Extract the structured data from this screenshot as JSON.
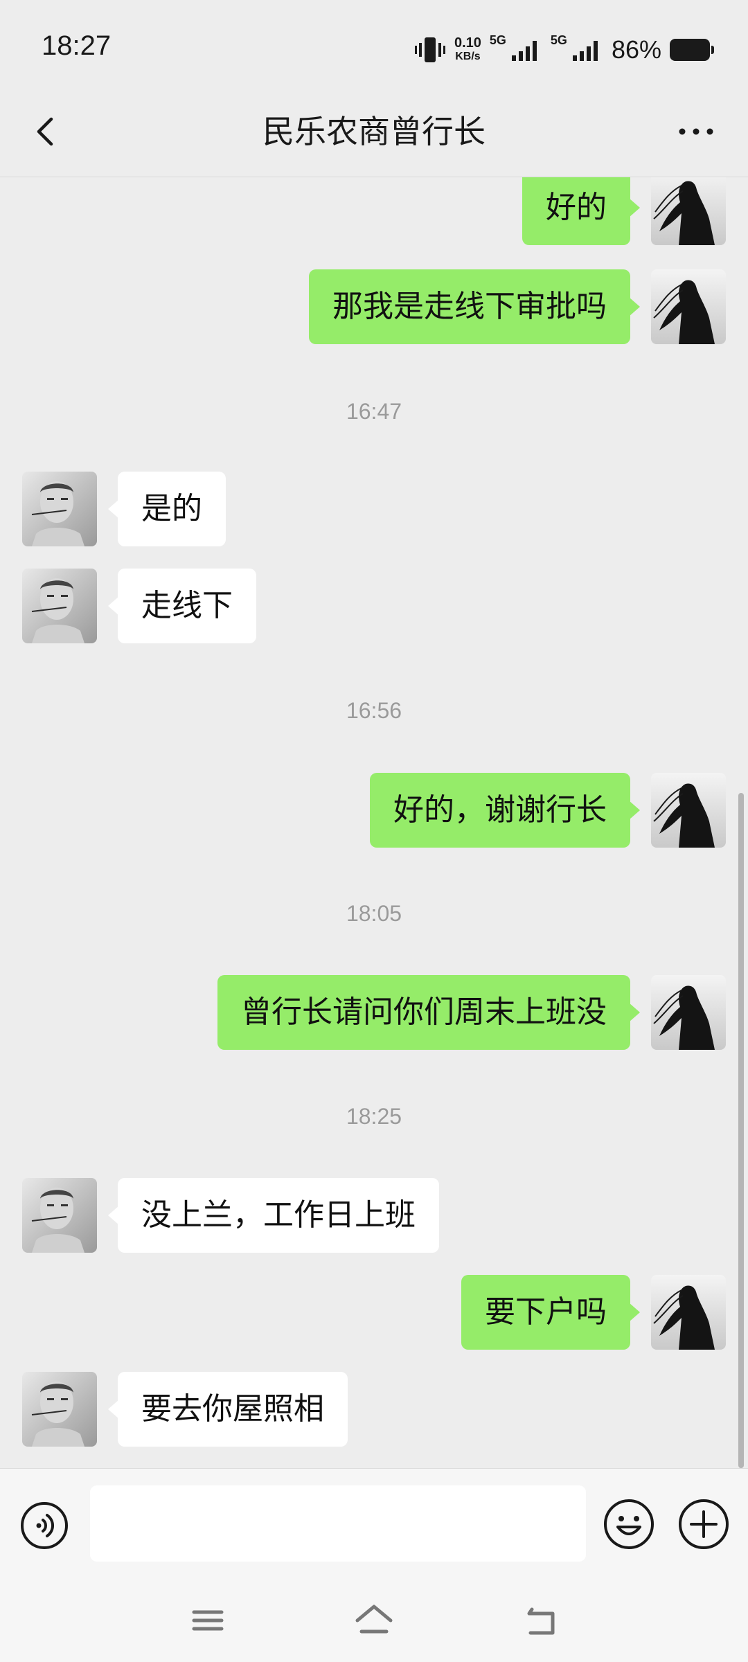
{
  "status_bar": {
    "time": "18:27",
    "net_speed": "0.10",
    "net_unit": "KB/s",
    "sim1_label": "5G",
    "sim2_label": "5G",
    "battery_percent": "86%"
  },
  "header": {
    "title": "民乐农商曾行长"
  },
  "messages": [
    {
      "side": "me",
      "text": "好的"
    },
    {
      "side": "me",
      "text": "那我是走线下审批吗"
    },
    {
      "timestamp": "16:47"
    },
    {
      "side": "them",
      "text": "是的"
    },
    {
      "side": "them",
      "text": "走线下"
    },
    {
      "timestamp": "16:56"
    },
    {
      "side": "me",
      "text": "好的，谢谢行长"
    },
    {
      "timestamp": "18:05"
    },
    {
      "side": "me",
      "text": "曾行长请问你们周末上班没"
    },
    {
      "timestamp": "18:25"
    },
    {
      "side": "them",
      "text": "没上兰，工作日上班"
    },
    {
      "side": "me",
      "text": "要下户吗"
    },
    {
      "side": "them",
      "text": "要去你屋照相"
    }
  ],
  "input": {
    "value": ""
  },
  "icons": {
    "back": "back-arrow-icon",
    "more": "more-dots-icon",
    "voice": "voice-icon",
    "emoji": "emoji-icon",
    "plus": "plus-icon",
    "nav_menu": "menu-icon",
    "nav_home": "home-icon",
    "nav_back": "back-icon"
  },
  "colors": {
    "outgoing_bubble": "#95ec69",
    "incoming_bubble": "#ffffff",
    "background": "#ededed"
  }
}
